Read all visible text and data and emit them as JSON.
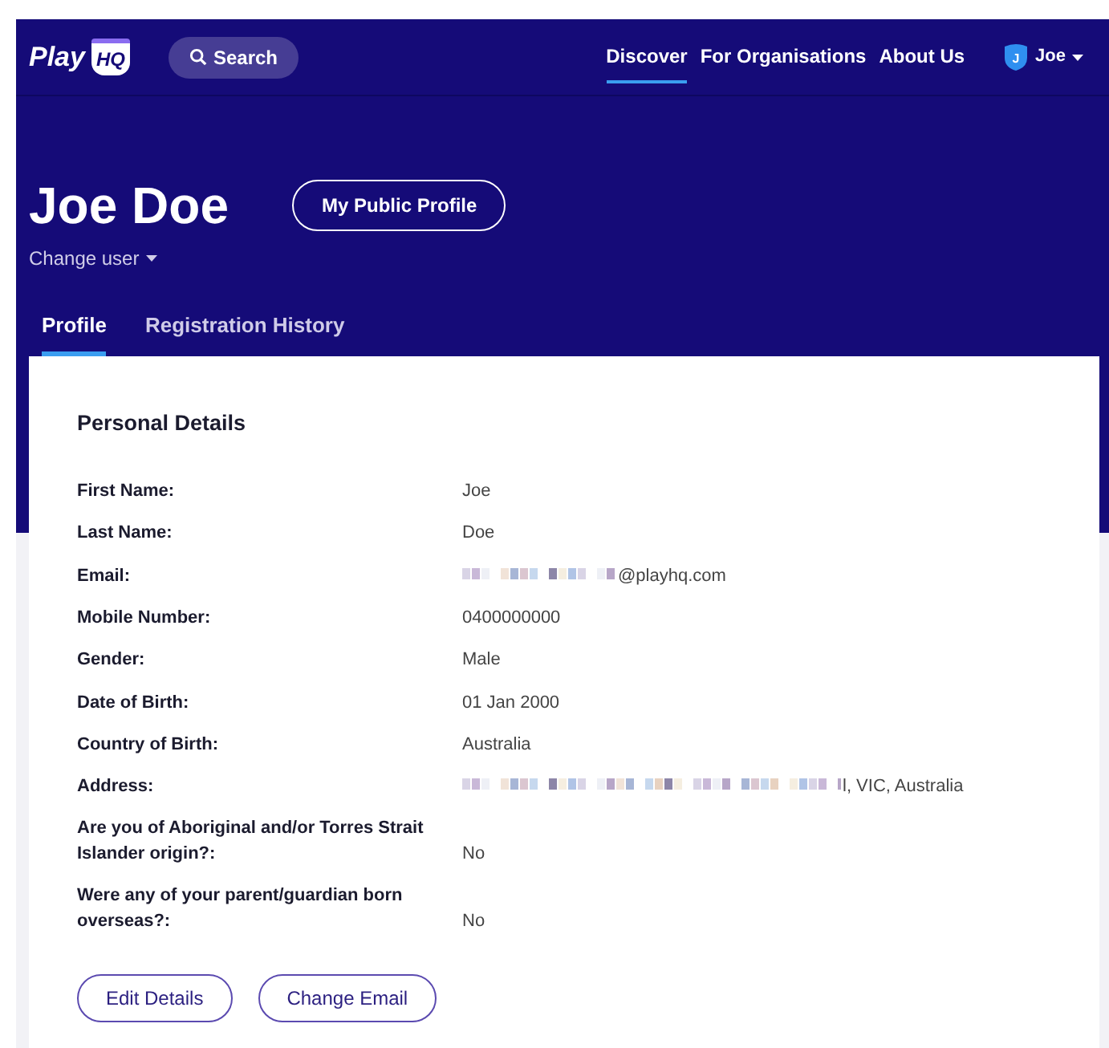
{
  "navbar": {
    "logo": {
      "text": "Play",
      "badge": "HQ"
    },
    "search": "Search",
    "links": [
      {
        "label": "Discover",
        "selected": true
      },
      {
        "label": "For Organisations",
        "selected": false
      },
      {
        "label": "About Us",
        "selected": false
      }
    ],
    "user": {
      "initial": "J",
      "name": "Joe"
    }
  },
  "profile": {
    "name": "Joe Doe",
    "public_button": "My Public Profile",
    "change_user": "Change user"
  },
  "tabs": [
    {
      "label": "Profile",
      "selected": true
    },
    {
      "label": "Registration History",
      "selected": false
    }
  ],
  "details": {
    "title": "Personal Details",
    "rows": [
      {
        "label": "First Name:",
        "value": "Joe",
        "redacted": false
      },
      {
        "label": "Last Name:",
        "value": "Doe",
        "redacted": false
      },
      {
        "label": "Email:",
        "value": "@playhq.com",
        "redacted": true
      },
      {
        "label": "Mobile Number:",
        "value": "0400000000",
        "redacted": false
      },
      {
        "label": "Gender:",
        "value": "Male",
        "redacted": false
      },
      {
        "label": "Date of Birth:",
        "value": "01 Jan 2000",
        "redacted": false
      },
      {
        "label": "Country of Birth:",
        "value": "Australia",
        "redacted": false
      },
      {
        "label": "Address:",
        "value": "l, VIC, Australia",
        "redacted": true
      },
      {
        "label": "Are you of Aboriginal and/or Torres Strait Islander origin?:",
        "value": "No",
        "redacted": false
      },
      {
        "label": "Were any of your parent/guardian born overseas?:",
        "value": "No",
        "redacted": false
      }
    ],
    "buttons": [
      "Edit Details",
      "Change Email"
    ]
  }
}
